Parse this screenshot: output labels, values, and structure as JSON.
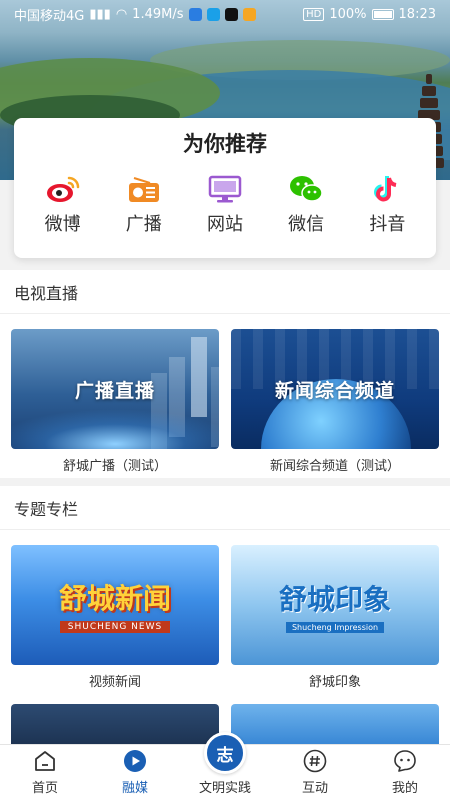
{
  "status_bar": {
    "carrier": "中国移动4G",
    "speed": "1.49M/s",
    "battery": "100%",
    "time": "18:23"
  },
  "recommend": {
    "title": "为你推荐",
    "items": [
      {
        "label": "微博",
        "icon": "weibo-icon"
      },
      {
        "label": "广播",
        "icon": "radio-icon"
      },
      {
        "label": "网站",
        "icon": "website-icon"
      },
      {
        "label": "微信",
        "icon": "wechat-icon"
      },
      {
        "label": "抖音",
        "icon": "douyin-icon"
      }
    ]
  },
  "tv_live": {
    "heading": "电视直播",
    "tiles": [
      {
        "thumb_text": "广播直播",
        "caption": "舒城广播（测试）"
      },
      {
        "thumb_text": "新闻综合频道",
        "caption": "新闻综合频道（测试）"
      }
    ]
  },
  "topics": {
    "heading": "专题专栏",
    "tiles": [
      {
        "thumb_text": "舒城新闻",
        "thumb_sub": "SHUCHENG NEWS",
        "caption": "视频新闻"
      },
      {
        "thumb_text": "舒城印象",
        "thumb_sub": "Shucheng Impression",
        "caption": "舒城印象"
      }
    ]
  },
  "bottom_nav": {
    "items": [
      {
        "label": "首页",
        "icon": "home-icon",
        "active": false
      },
      {
        "label": "融媒",
        "icon": "play-circle-icon",
        "active": true
      },
      {
        "label": "文明实践",
        "icon": "civilization-icon",
        "active": false
      },
      {
        "label": "互动",
        "icon": "hashtag-icon",
        "active": false
      },
      {
        "label": "我的",
        "icon": "profile-icon",
        "active": false
      }
    ],
    "center_glyph": "志"
  },
  "colors": {
    "accent": "#1a5fb4",
    "weibo": "#e6162d",
    "radio": "#f08a24",
    "website": "#9b59d0",
    "wechat": "#2dc100",
    "douyin": "#fe2c55"
  }
}
